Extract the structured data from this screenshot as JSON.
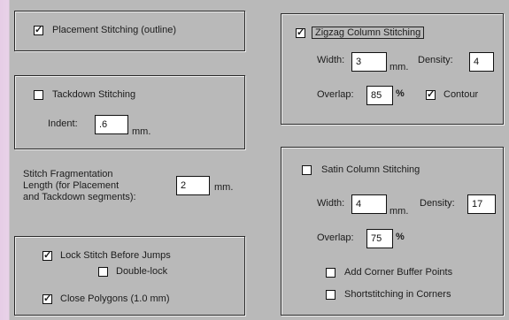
{
  "placement": {
    "label": "Placement Stitching (outline)",
    "checked": true
  },
  "tackdown": {
    "label": "Tackdown Stitching",
    "checked": false,
    "indent_label": "Indent:",
    "indent_value": ".6",
    "indent_unit": "mm."
  },
  "fragmentation": {
    "line1": "Stitch Fragmentation",
    "line2": "Length  (for Placement",
    "line3": "and Tackdown segments):",
    "value": "2",
    "unit": "mm."
  },
  "lock": {
    "lock_label": "Lock Stitch Before Jumps",
    "lock_checked": true,
    "double_label": "Double-lock",
    "double_checked": false,
    "close_label": "Close Polygons (1.0 mm)",
    "close_checked": true
  },
  "zigzag": {
    "label": "Zigzag Column Stitching",
    "checked": true,
    "width_label": "Width:",
    "width_value": "3",
    "width_unit": "mm.",
    "density_label": "Density:",
    "density_value": "4",
    "overlap_label": "Overlap:",
    "overlap_value": "85",
    "overlap_unit": "%",
    "contour_label": "Contour",
    "contour_checked": true
  },
  "satin": {
    "label": "Satin Column Stitching",
    "checked": false,
    "width_label": "Width:",
    "width_value": "4",
    "width_unit": "mm.",
    "density_label": "Density:",
    "density_value": "17",
    "overlap_label": "Overlap:",
    "overlap_value": "75",
    "overlap_unit": "%",
    "corner_buffer_label": "Add Corner Buffer Points",
    "corner_buffer_checked": false,
    "short_label": "Shortstitching in Corners",
    "short_checked": false
  },
  "check_glyph": "✓"
}
